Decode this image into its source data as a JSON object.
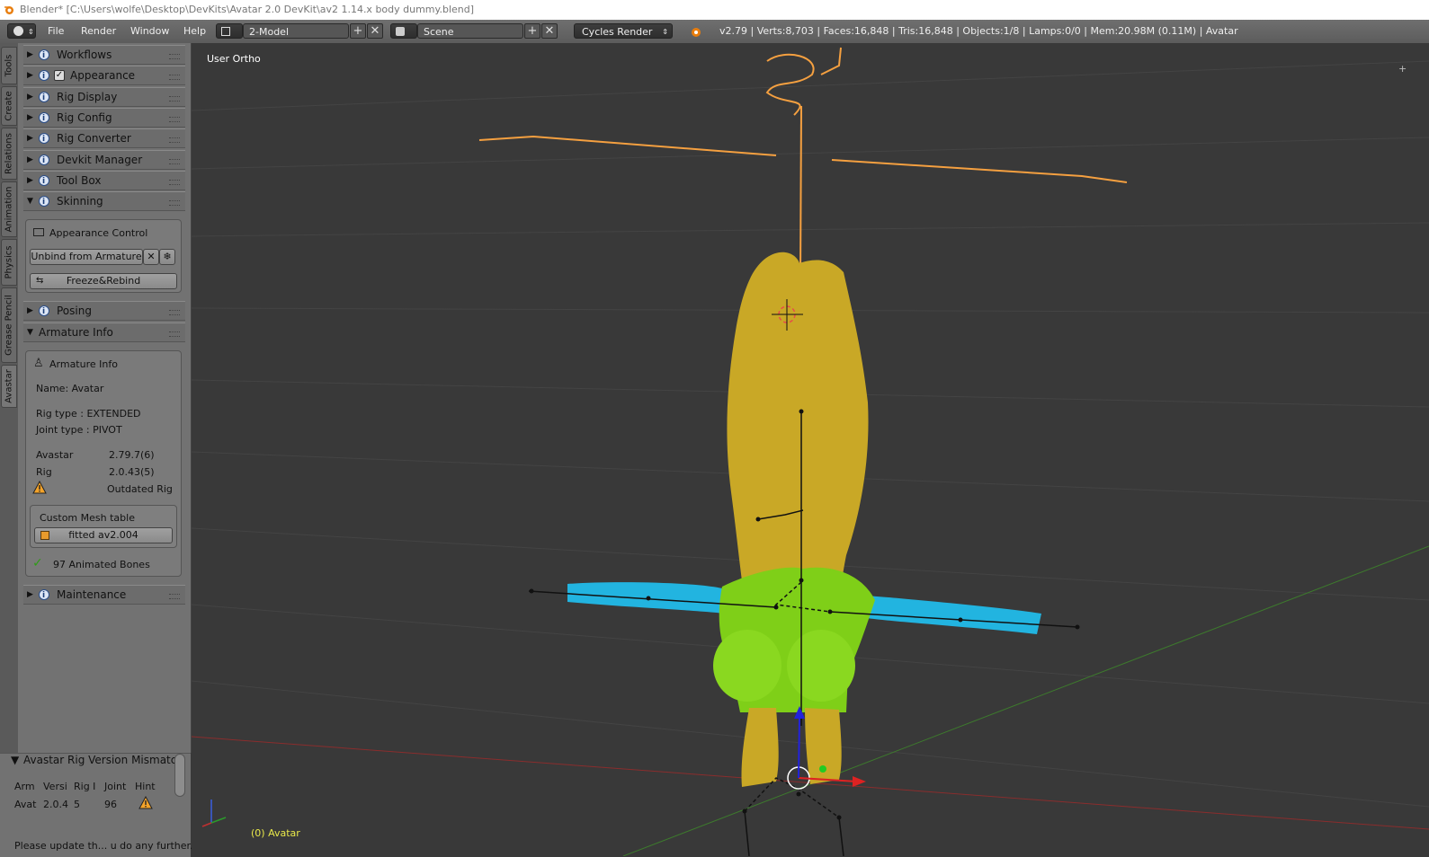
{
  "title_bar": {
    "title": "Blender* [C:\\Users\\wolfe\\Desktop\\DevKits\\Avatar 2.0 DevKit\\av2 1.14.x body dummy.blend]"
  },
  "menu": {
    "items": [
      "File",
      "Render",
      "Window",
      "Help"
    ],
    "screen_layout": "2-Model",
    "scene": "Scene",
    "render_engine": "Cycles Render",
    "stats": "v2.79 | Verts:8,703 | Faces:16,848 | Tris:16,848 | Objects:1/8 | Lamps:0/0 | Mem:20.98M (0.11M) | Avatar"
  },
  "tool_tabs": [
    "Tools",
    "Create",
    "Relations",
    "Animation",
    "Physics",
    "Grease Pencil",
    "Avastar"
  ],
  "panels": {
    "workflows": "Workflows",
    "appearance": "Appearance",
    "rig_display": "Rig Display",
    "rig_config": "Rig Config",
    "rig_converter": "Rig Converter",
    "devkit_manager": "Devkit Manager",
    "tool_box": "Tool Box",
    "skinning": "Skinning",
    "posing": "Posing",
    "armature_info": "Armature Info",
    "maintenance": "Maintenance"
  },
  "skinning": {
    "section_label": "Appearance Control",
    "unbind_label": "Unbind from Armature",
    "freeze_label": "Freeze&Rebind"
  },
  "armature": {
    "heading": "Armature Info",
    "name": "Name: Avatar",
    "rig_type": "Rig type    : EXTENDED",
    "joint_type": "Joint type : PIVOT",
    "avastar_label": "Avastar",
    "avastar_version": "2.79.7(6)",
    "rig_label": "Rig",
    "rig_version": "2.0.43(5)",
    "outdated": "Outdated Rig",
    "custom_mesh_label": "Custom Mesh table",
    "mesh_name": "fitted av2.004",
    "bones": "97 Animated Bones"
  },
  "mismatch": {
    "title": "Avastar Rig Version Mismatch",
    "columns": [
      "Arm",
      "Versi",
      "Rig I",
      "Joint",
      "Hint"
    ],
    "row": [
      "Avat",
      "2.0.4",
      "5",
      "96"
    ],
    "footer": "Please update th... u do any further..."
  },
  "viewport": {
    "view_label": "User Ortho",
    "object_label": "(0) Avatar"
  },
  "colors": {
    "bone_orange": "#f5a040",
    "body_yellow": "#c9a826",
    "torso_green": "#7fcf18",
    "arm_blue": "#22b4e0"
  }
}
